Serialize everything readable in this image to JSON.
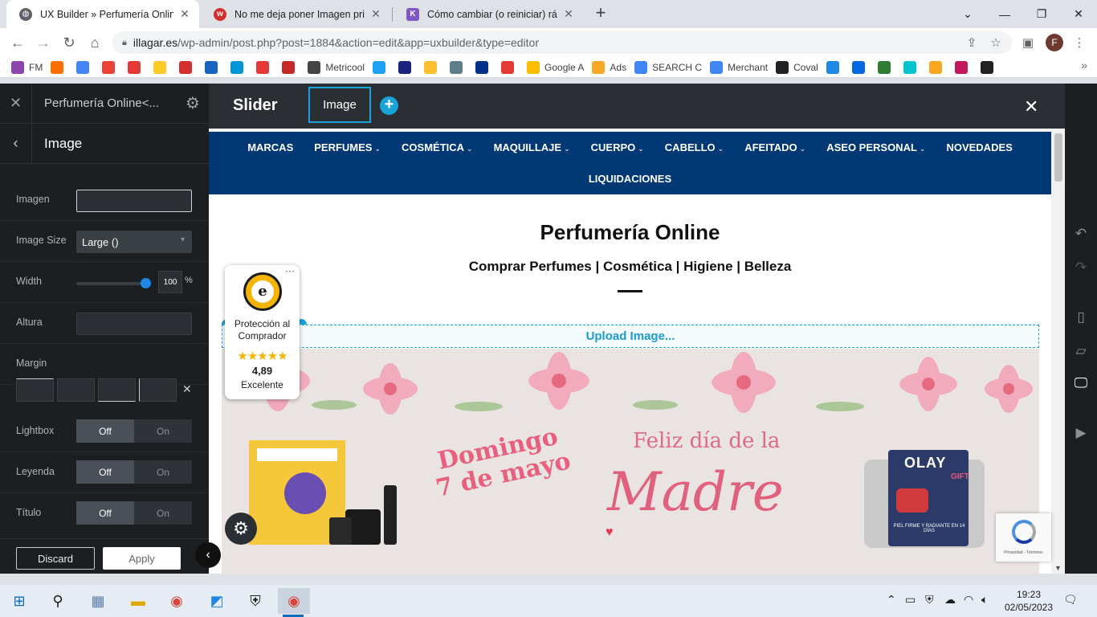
{
  "browser": {
    "tabs": [
      {
        "title": "UX Builder » Perfumería Online<l",
        "favicon": "globe-icon",
        "active": true
      },
      {
        "title": "No me deja poner Imagen princip",
        "favicon": "wordpress-red-icon",
        "active": false
      },
      {
        "title": "Cómo cambiar (o reiniciar) rápid",
        "favicon": "k-icon",
        "active": false
      }
    ],
    "new_tab": "+",
    "window_controls": {
      "minimize": "—",
      "restore": "❐",
      "close": "✕",
      "tablist": "⌄"
    },
    "url_host": "illagar.es",
    "url_path": "/wp-admin/post.php?post=1884&action=edit&app=uxbuilder&type=editor",
    "profile_initial": "F",
    "bookmarks": [
      {
        "label": "FM",
        "icon": "fm-icon",
        "color": "#8e44ad"
      },
      {
        "label": "",
        "icon": "rtve-icon",
        "color": "#ff6f00"
      },
      {
        "label": "",
        "icon": "calendar-icon",
        "color": "#4285f4"
      },
      {
        "label": "",
        "icon": "gmail-icon",
        "color": "#ea4335"
      },
      {
        "label": "",
        "icon": "red-icon",
        "color": "#e53935"
      },
      {
        "label": "",
        "icon": "amazon-icon",
        "color": "#ffca28"
      },
      {
        "label": "",
        "icon": "a-red-icon",
        "color": "#d32f2f"
      },
      {
        "label": "",
        "icon": "blue-circle-icon",
        "color": "#1565c0"
      },
      {
        "label": "",
        "icon": "hp-icon",
        "color": "#0096d6"
      },
      {
        "label": "",
        "icon": "red-dot-icon",
        "color": "#e53935"
      },
      {
        "label": "",
        "icon": "circle-icon",
        "color": "#c62828"
      },
      {
        "label": "Metricool",
        "icon": "metricool-icon",
        "color": "#444444"
      },
      {
        "label": "",
        "icon": "twitter-icon",
        "color": "#1da1f2"
      },
      {
        "label": "",
        "icon": "dark-icon",
        "color": "#1a237e"
      },
      {
        "label": "",
        "icon": "yellow-icon",
        "color": "#fbc02d"
      },
      {
        "label": "",
        "icon": "bird-icon",
        "color": "#607d8b"
      },
      {
        "label": "",
        "icon": "paypal-icon",
        "color": "#003087"
      },
      {
        "label": "",
        "icon": "w-icon",
        "color": "#e53935"
      },
      {
        "label": "Google A",
        "icon": "google-ads-icon",
        "color": "#fbbc04"
      },
      {
        "label": "Ads",
        "icon": "analytics-icon",
        "color": "#f9a825"
      },
      {
        "label": "SEARCH C",
        "icon": "search-console-icon",
        "color": "#4285f4"
      },
      {
        "label": "Merchant",
        "icon": "merchant-icon",
        "color": "#4285f4"
      },
      {
        "label": "Coval",
        "icon": "coval-icon",
        "color": "#202124"
      },
      {
        "label": "",
        "icon": "c-blue-icon",
        "color": "#1e88e5"
      },
      {
        "label": "",
        "icon": "meta-icon",
        "color": "#0668e1"
      },
      {
        "label": "",
        "icon": "plus-green-icon",
        "color": "#2e7d32"
      },
      {
        "label": "",
        "icon": "canva-icon",
        "color": "#00c4cc"
      },
      {
        "label": "",
        "icon": "gear-yellow-icon",
        "color": "#f9a825"
      },
      {
        "label": "",
        "icon": "d-icon",
        "color": "#c2185b"
      },
      {
        "label": "",
        "icon": "pr-icon",
        "color": "#212121"
      }
    ],
    "more": "»"
  },
  "builder": {
    "page_title": "Perfumería Online<...",
    "section_title": "Image",
    "options": {
      "imagen": {
        "label": "Imagen",
        "value": ""
      },
      "image_size": {
        "label": "Image Size",
        "value": "Large ()"
      },
      "width": {
        "label": "Width",
        "value": "100",
        "unit": "%",
        "level_percent": 100
      },
      "altura": {
        "label": "Altura",
        "value": ""
      },
      "margin": {
        "label": "Margin",
        "clear": "✕"
      },
      "lightbox": {
        "label": "Lightbox",
        "off": "Off",
        "on": "On"
      },
      "leyenda": {
        "label": "Leyenda",
        "off": "Off",
        "on": "On"
      },
      "titulo": {
        "label": "Título",
        "off": "Off",
        "on": "On"
      }
    },
    "discard": "Discard",
    "apply": "Apply"
  },
  "canvas": {
    "slider_label": "Slider",
    "image_tab": "Image",
    "add": "+",
    "nav_row1": [
      "MARCAS",
      "PERFUMES",
      "COSMÉTICA",
      "MAQUILLAJE",
      "CUERPO",
      "CABELLO",
      "AFEITADO",
      "ASEO PERSONAL",
      "NOVEDADES"
    ],
    "nav_row1_dropdown": [
      false,
      true,
      true,
      true,
      true,
      true,
      true,
      true,
      false
    ],
    "nav_row2": [
      "LIQUIDACIONES"
    ],
    "site_title": "Perfumería Online",
    "site_subtitle": "Comprar Perfumes | Cosmética | Higiene | Belleza",
    "upload_label": "Upload Image...",
    "banner": {
      "promo_left": [
        "Domingo",
        "7 de mayo"
      ],
      "feliz": "Feliz día de la",
      "madre": "Madre",
      "olay": "OLAY",
      "gift": "GIFT",
      "olay_foot": "PIEL FIRME Y RADIANTE EN 14 DÍAS"
    },
    "trust": {
      "line1": "Protección al",
      "line2": "Comprador",
      "stars": "★★★★★",
      "score": "4,89",
      "rating": "Excelente",
      "more": "···"
    },
    "recaptcha_text": "Privacidad - Términos"
  },
  "taskbar": {
    "time": "19:23",
    "date": "02/05/2023"
  }
}
